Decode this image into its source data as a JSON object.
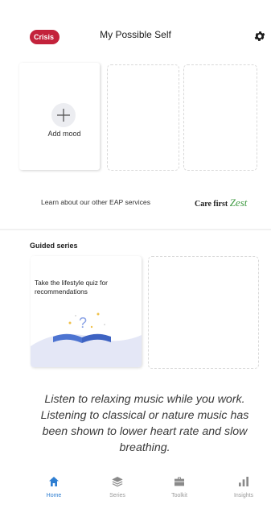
{
  "header": {
    "crisis_label": "Crisis",
    "title": "My Possible Self",
    "settings_icon": "gear-icon"
  },
  "mood": {
    "add_label": "Add mood",
    "add_icon": "plus-icon"
  },
  "eap": {
    "text": "Learn about our other EAP services",
    "logo_text": "Care first",
    "logo_script": "Zest"
  },
  "guided": {
    "section_title": "Guided series",
    "card_text": "Take the lifestyle quiz for recommendations",
    "card_icon": "book-quiz-illustration"
  },
  "tip": {
    "text": "Listen to relaxing music while you work. Listening to classical or nature music has been shown to lower heart rate and slow breathing."
  },
  "nav": {
    "items": [
      {
        "label": "Home",
        "icon": "home-icon",
        "active": true
      },
      {
        "label": "Series",
        "icon": "layers-icon",
        "active": false
      },
      {
        "label": "Toolkit",
        "icon": "briefcase-icon",
        "active": false
      },
      {
        "label": "Insights",
        "icon": "bar-chart-icon",
        "active": false
      }
    ]
  },
  "colors": {
    "crisis": "#c3223b",
    "accent": "#2e7ed1",
    "zest_green": "#3f9a42"
  }
}
